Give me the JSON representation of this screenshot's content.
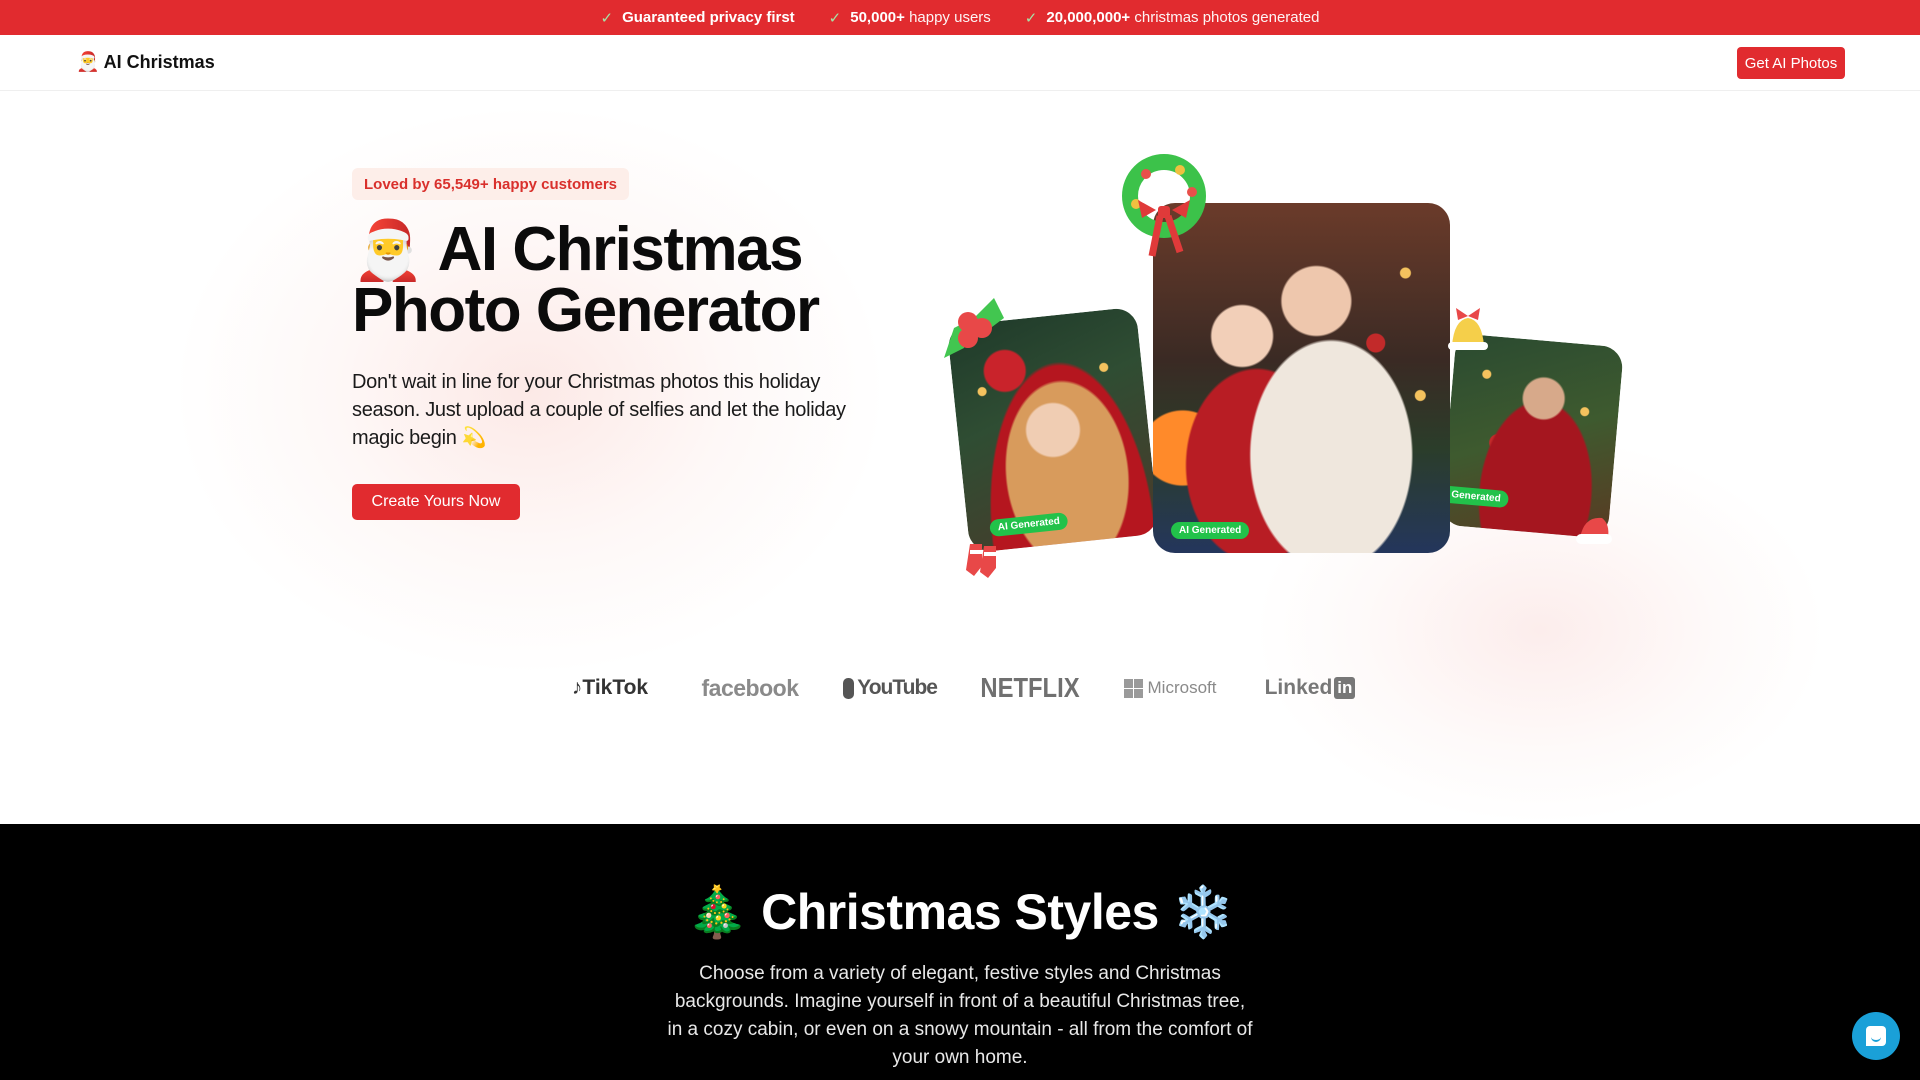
{
  "announcement": {
    "items": [
      {
        "bold": "Guaranteed privacy first",
        "rest": ""
      },
      {
        "bold": "50,000+",
        "rest": "happy users"
      },
      {
        "bold": "20,000,000+",
        "rest": "christmas photos generated"
      }
    ],
    "icon": "check-icon"
  },
  "nav": {
    "brand_emoji": "🎅",
    "brand_name": "AI Christmas",
    "cta_label": "Get AI Photos"
  },
  "hero": {
    "badge": "Loved by 65,549+ happy customers",
    "title_emoji": "🎅",
    "title_line1": "AI Christmas",
    "title_line2": "Photo Generator",
    "description": "Don't wait in line for your Christmas photos this holiday season. Just upload a couple of selfies and let the holiday magic begin",
    "description_emoji": "💫",
    "cta_label": "Create Yours Now",
    "photos": [
      {
        "subject": "woman-in-santa-hat",
        "tag": "AI Generated"
      },
      {
        "subject": "mother-and-daughter-by-fireplace",
        "tag": "AI Generated"
      },
      {
        "subject": "man-in-red-coat",
        "tag": "AI Generated"
      }
    ],
    "decorations": {
      "wreath": "🎄",
      "holly": "🍒",
      "bell": "🔔",
      "stockings": "🧦",
      "hat": "🎅"
    }
  },
  "logos": [
    "TikTok",
    "facebook",
    "YouTube",
    "NETFLIX",
    "Microsoft",
    "Linked"
  ],
  "logo_suffix": {
    "linkedin": "in"
  },
  "styles_section": {
    "title_emoji_left": "🎄",
    "title": "Christmas Styles",
    "title_emoji_right": "❄️",
    "description": "Choose from a variety of elegant, festive styles and Christmas backgrounds. Imagine yourself in front of a beautiful Christmas tree, in a cozy cabin, or even on a snowy mountain - all from the comfort of your own home."
  },
  "colors": {
    "brand_red": "#e12b2f",
    "badge_bg": "#fdeee9",
    "ai_tag_green": "#22c24a",
    "chat_blue": "#1aa0d8"
  },
  "chat_widget": {
    "icon": "chat-icon"
  }
}
